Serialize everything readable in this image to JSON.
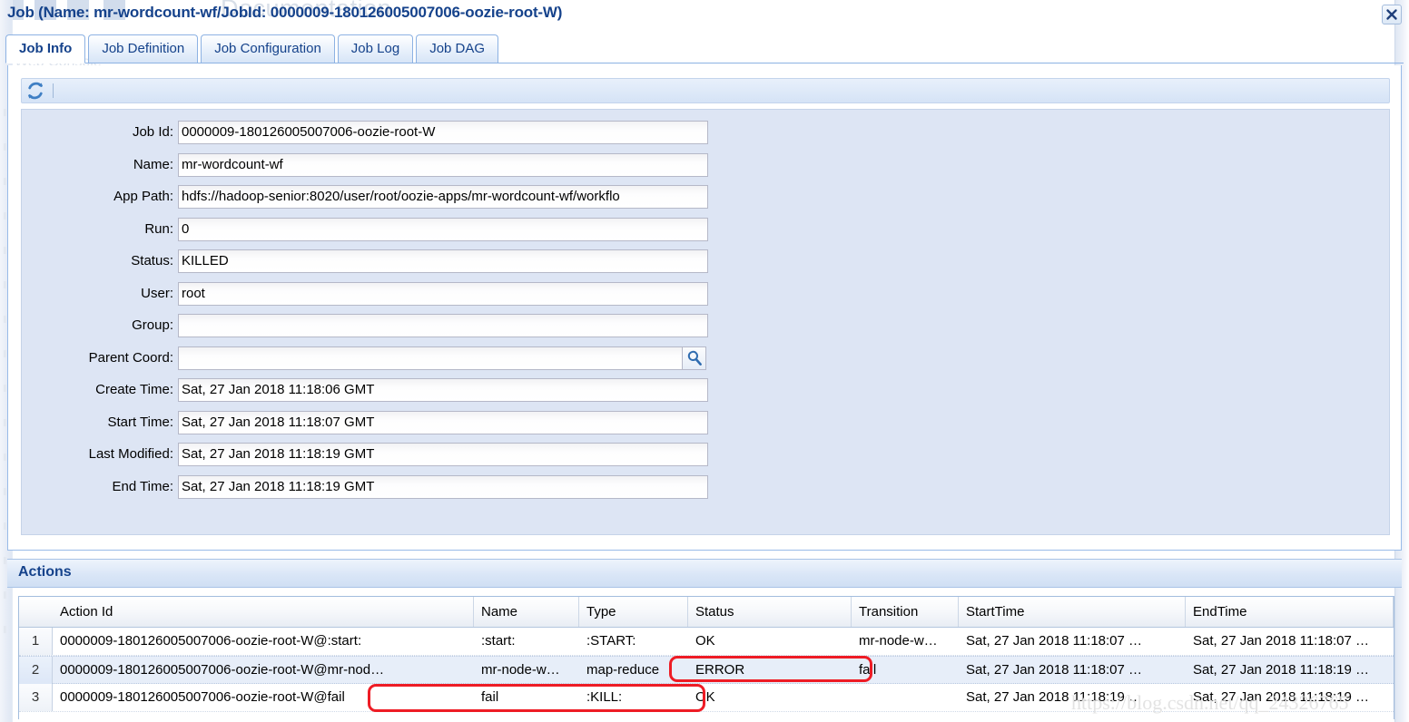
{
  "background": {
    "doc_text": "Documentation",
    "sub_text": "i Web Console",
    "watermark": "https://blog.csdn.net/qq_24326765"
  },
  "dialog": {
    "title": "Job (Name: mr-wordcount-wf/JobId: 0000009-180126005007006-oozie-root-W)",
    "close_icon": "close-icon"
  },
  "tabs": [
    {
      "label": "Job Info",
      "active": true
    },
    {
      "label": "Job Definition",
      "active": false
    },
    {
      "label": "Job Configuration",
      "active": false
    },
    {
      "label": "Job Log",
      "active": false
    },
    {
      "label": "Job DAG",
      "active": false
    }
  ],
  "toolbar": {
    "refresh_icon": "refresh-icon"
  },
  "form": {
    "fields": [
      {
        "label": "Job Id:",
        "value": "0000009-180126005007006-oozie-root-W"
      },
      {
        "label": "Name:",
        "value": "mr-wordcount-wf"
      },
      {
        "label": "App Path:",
        "value": "hdfs://hadoop-senior:8020/user/root/oozie-apps/mr-wordcount-wf/workflo"
      },
      {
        "label": "Run:",
        "value": "0"
      },
      {
        "label": "Status:",
        "value": "KILLED"
      },
      {
        "label": "User:",
        "value": "root"
      },
      {
        "label": "Group:",
        "value": ""
      },
      {
        "label": "Parent Coord:",
        "value": "",
        "has_search": true,
        "search_icon": "search-icon"
      },
      {
        "label": "Create Time:",
        "value": "Sat, 27 Jan 2018 11:18:06 GMT"
      },
      {
        "label": "Start Time:",
        "value": "Sat, 27 Jan 2018 11:18:07 GMT"
      },
      {
        "label": "Last Modified:",
        "value": "Sat, 27 Jan 2018 11:18:19 GMT"
      },
      {
        "label": "End Time:",
        "value": "Sat, 27 Jan 2018 11:18:19 GMT"
      }
    ]
  },
  "actions": {
    "section_label": "Actions",
    "columns": [
      "Action Id",
      "Name",
      "Type",
      "Status",
      "Transition",
      "StartTime",
      "EndTime"
    ],
    "rows": [
      {
        "num": "1",
        "action_id": "0000009-180126005007006-oozie-root-W@:start:",
        "name": ":start:",
        "type": ":START:",
        "status": "OK",
        "transition": "mr-node-w…",
        "start_time": "Sat, 27 Jan 2018 11:18:07 …",
        "end_time": "Sat, 27 Jan 2018 11:18:07 …"
      },
      {
        "num": "2",
        "action_id": "0000009-180126005007006-oozie-root-W@mr-nod…",
        "name": "mr-node-w…",
        "type": "map-reduce",
        "status": "ERROR",
        "transition": "fail",
        "start_time": "Sat, 27 Jan 2018 11:18:07 …",
        "end_time": "Sat, 27 Jan 2018 11:18:19 …"
      },
      {
        "num": "3",
        "action_id": "0000009-180126005007006-oozie-root-W@fail",
        "name": "fail",
        "type": ":KILL:",
        "status": "OK",
        "transition": "",
        "start_time": "Sat, 27 Jan 2018 11:18:19 …",
        "end_time": "Sat, 27 Jan 2018 11:18:19 …"
      }
    ]
  },
  "colors": {
    "title_blue": "#15428b",
    "panel_bg": "#dde5f4",
    "annotation_red": "#ee1c25",
    "row_highlight": "#e7eef9"
  }
}
